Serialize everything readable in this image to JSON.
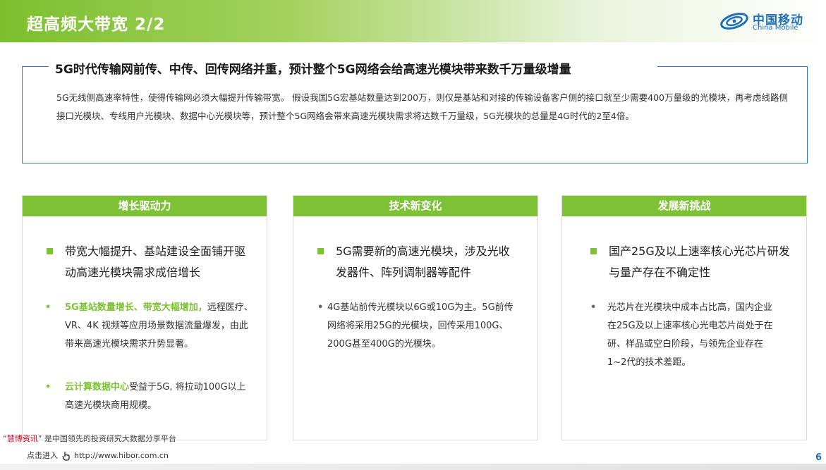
{
  "header": {
    "title": "超高频大带宽 2/2",
    "logo_cn": "中国移动",
    "logo_en": "China Mobile"
  },
  "summary": {
    "title": "5G时代传输网前传、中传、回传网络并重，预计整个5G网络会给高速光模块带来数千万量级增量",
    "body": "5G无线侧高速率特性，使得传输网必须大幅提升传输带宽。 假设我国5G宏基站数量达到200万，则仅是基站和对接的传输设备客户侧的接口就至少需要400万量级的光模块，再考虑线路侧接口光模块、专线用户光模块、数据中心光模块等，预计整个5G网络会带来高速光模块需求将达数千万量级，5G光模块的总量是4G时代的2至4倍。"
  },
  "cards": [
    {
      "title": "增长驱动力",
      "main": "带宽大幅提升、基站建设全面铺开驱动高速光模块需求成倍增长",
      "subs": [
        {
          "highlight": "5G基站数量增长、带宽大幅增加，",
          "text": "远程医疗、VR、4K 视频等应用场景数据流量爆发，由此带来高速光模块需求升势显著。"
        },
        {
          "highlight": "云计算数据中心",
          "text": "受益于5G, 将拉动100G以上高速光模块商用规模。"
        }
      ]
    },
    {
      "title": "技术新变化",
      "main": "5G需要新的高速光模块，涉及光收发器件、阵列调制器等配件",
      "subs": [
        {
          "highlight": "",
          "text": "4G基站前传光模块以6G或10G为主。5G前传网络将采用25G的光模块，回传采用100G、200G甚至400G的光模块。"
        }
      ]
    },
    {
      "title": "发展新挑战",
      "main": "国产25G及以上速率核心光芯片研发与量产存在不确定性",
      "subs": [
        {
          "highlight": "",
          "text": "光芯片在光模块中成本占比高，国内企业在25G及以上速率核心光电芯片尚处于在研、样品或空白阶段，与领先企业存在1~2代的技术差距。"
        }
      ]
    }
  ],
  "footer": {
    "brand": "“慧博资讯”",
    "note": "是中国领先的投资研究大数据分享平台",
    "link_prefix": "点击进入",
    "link_url": "http://www.hibor.com.cn",
    "page": "6"
  },
  "colors": {
    "accent_green": "#7cc234",
    "brand_blue": "#1d6fb8",
    "box_border": "#2f77c6"
  }
}
